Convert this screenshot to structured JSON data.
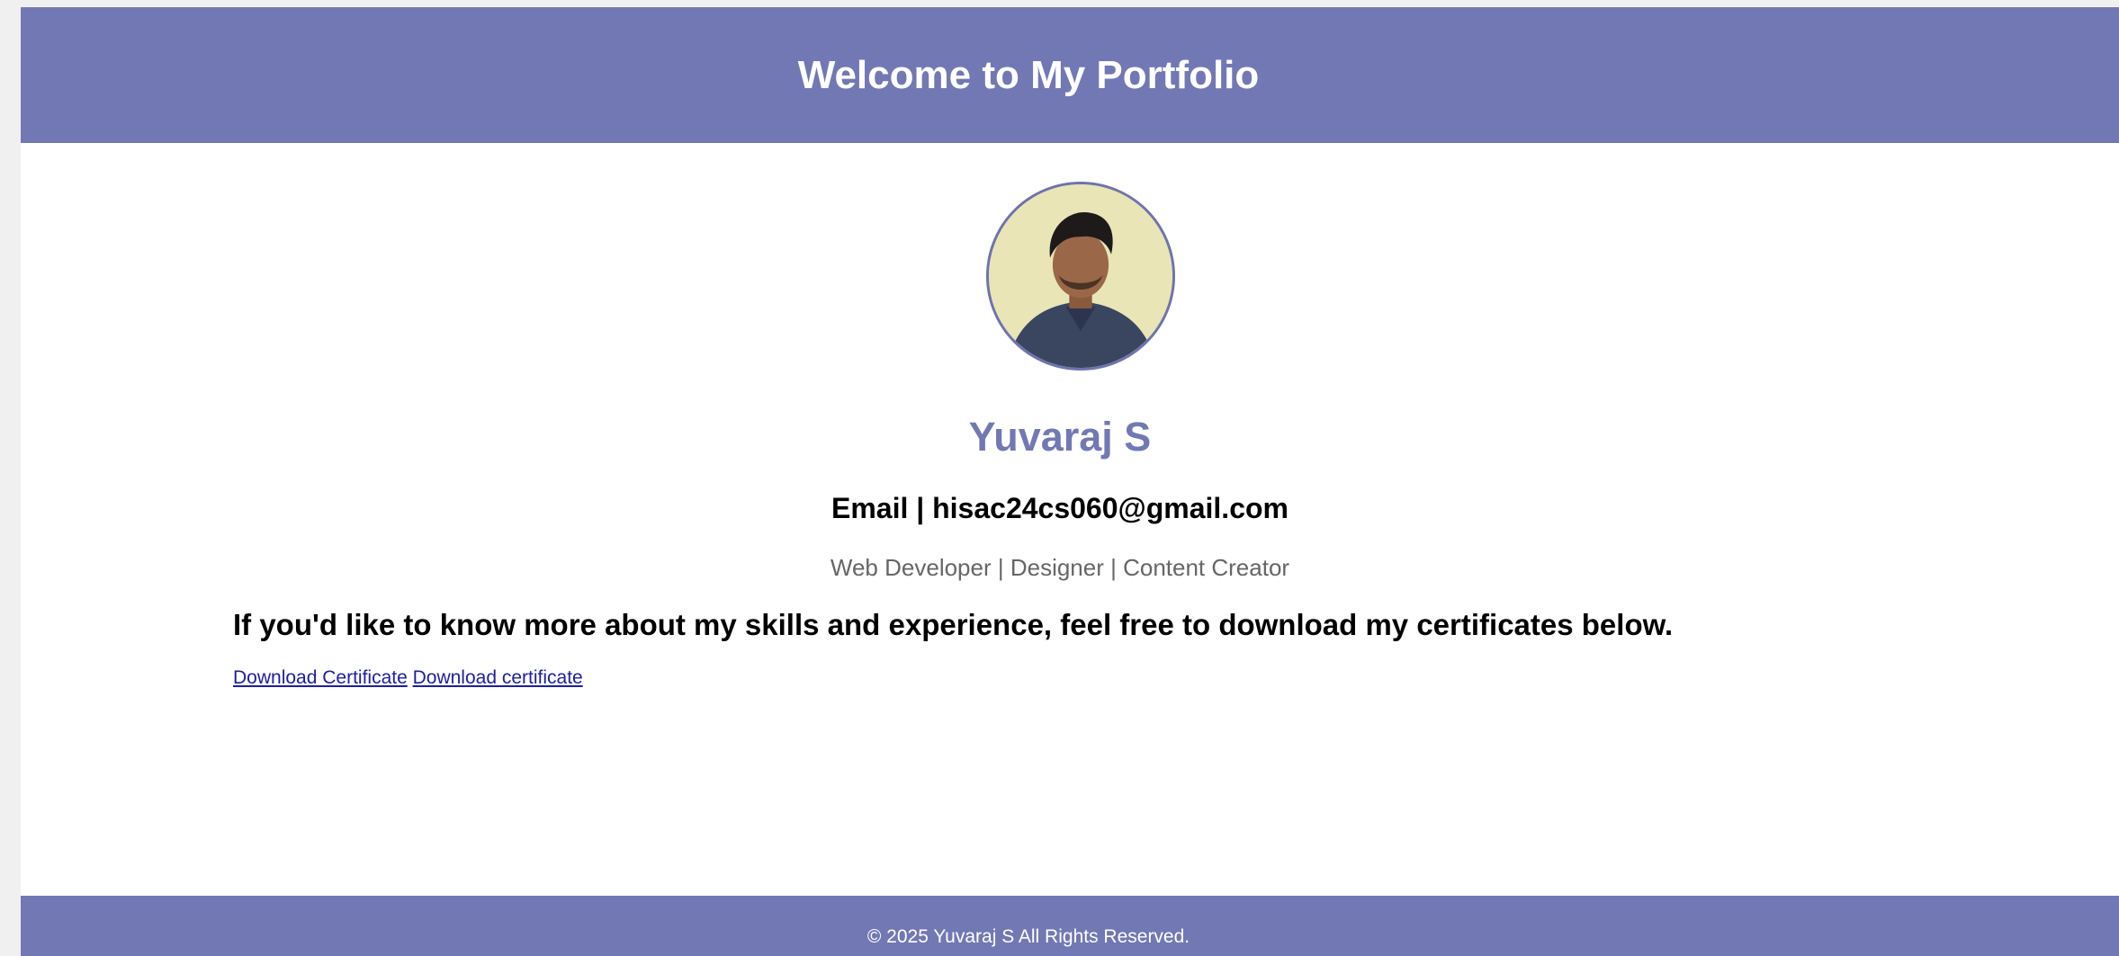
{
  "header": {
    "title": "Welcome to My Portfolio"
  },
  "profile": {
    "avatar_icon": "profile-photo",
    "name": "Yuvaraj S",
    "email_line": "Email | hisac24cs060@gmail.com",
    "roles": "Web Developer | Designer | Content Creator"
  },
  "main": {
    "intro": "If you'd like to know more about my skills and experience, feel free to download my certificates below.",
    "links": [
      {
        "label": "Download Certificate"
      },
      {
        "label": "Download certificate"
      }
    ]
  },
  "footer": {
    "text": "© 2025 Yuvaraj S All Rights Reserved."
  },
  "colors": {
    "brand": "#7278b4",
    "link": "#1b1fa0",
    "muted": "#666666"
  }
}
